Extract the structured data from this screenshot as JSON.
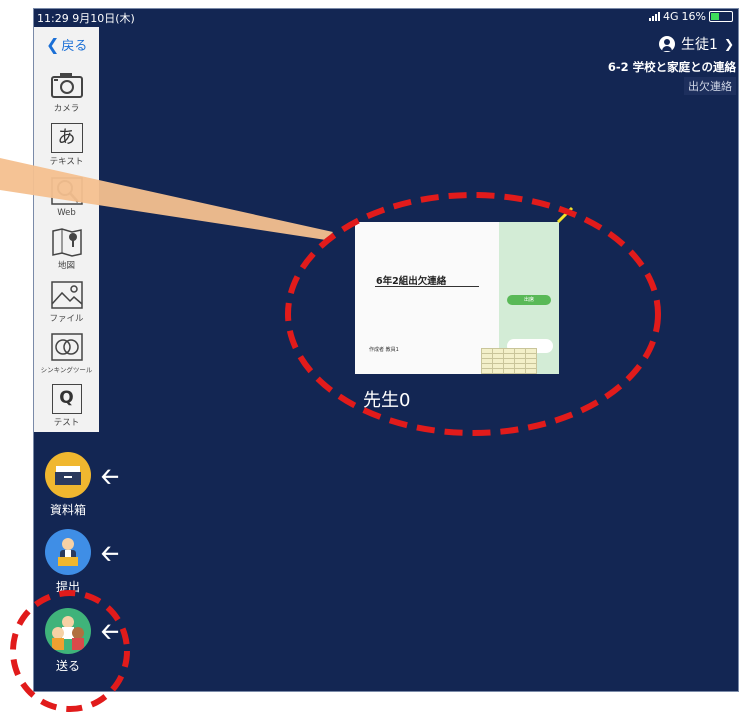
{
  "status": {
    "time_date": "11:29  9月10日(木)",
    "network": "4G",
    "battery": "16%"
  },
  "header": {
    "user_name": "生徒1",
    "lesson_title": "6-2 学校と家庭との連絡",
    "lesson_subtitle": "出欠連絡"
  },
  "toolbar": {
    "back_label": "戻る",
    "tools": [
      {
        "label": "カメラ",
        "icon": "camera-icon"
      },
      {
        "label": "テキスト",
        "icon": "text-icon",
        "glyph": "あ"
      },
      {
        "label": "Web",
        "icon": "web-search-icon"
      },
      {
        "label": "地図",
        "icon": "map-icon"
      },
      {
        "label": "ファイル",
        "icon": "image-file-icon"
      },
      {
        "label": "シンキングツール",
        "icon": "thinking-tool-icon"
      },
      {
        "label": "テスト",
        "icon": "test-icon",
        "glyph": "Q"
      }
    ]
  },
  "side_buttons": [
    {
      "label": "資料箱",
      "icon": "materials-box-icon"
    },
    {
      "label": "提出",
      "icon": "submit-icon"
    },
    {
      "label": "送る",
      "icon": "send-icon"
    }
  ],
  "card": {
    "title": "6年2組出欠連絡",
    "author": "作成者 教員1",
    "button_label": "出席"
  },
  "teacher_label": "先生0",
  "colors": {
    "background": "#132653",
    "panel": "#f2f2f2",
    "annotation_red": "#e11b1b",
    "pointer_orange": "#f4c08f"
  }
}
